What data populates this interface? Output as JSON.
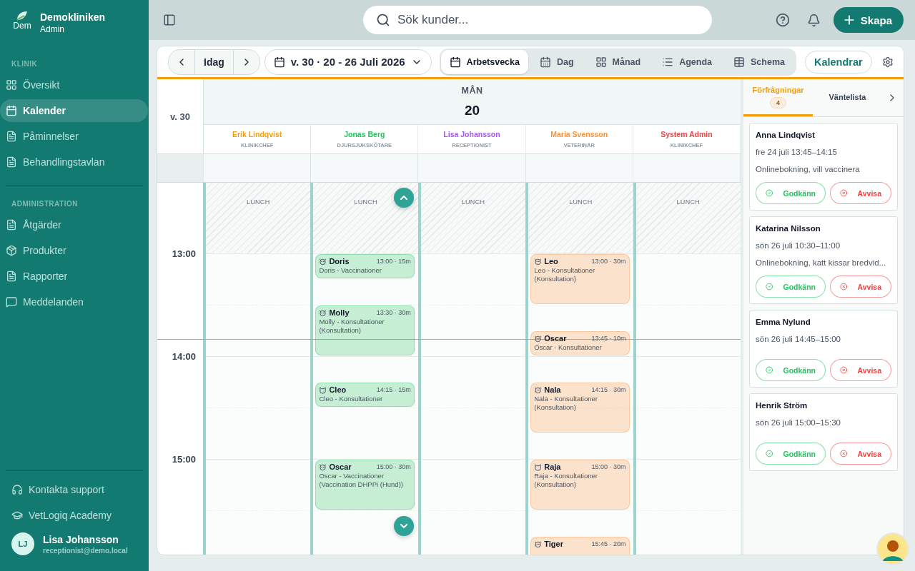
{
  "sidebar": {
    "clinic": {
      "logo_alt": "Dem",
      "name": "Demokliniken",
      "role": "Admin"
    },
    "sections": [
      {
        "title": "KLINIK",
        "items": [
          {
            "label": "Översikt",
            "kind": "grid",
            "selected": false
          },
          {
            "label": "Kalender",
            "kind": "calendar",
            "selected": true
          },
          {
            "label": "Påminnelser",
            "kind": "document",
            "selected": false
          },
          {
            "label": "Behandlingstavlan",
            "kind": "document",
            "selected": false
          }
        ]
      },
      {
        "title": "ADMINISTRATION",
        "items": [
          {
            "label": "Åtgärder",
            "kind": "document",
            "selected": false
          },
          {
            "label": "Produkter",
            "kind": "box",
            "selected": false
          },
          {
            "label": "Rapporter",
            "kind": "document",
            "selected": false
          },
          {
            "label": "Meddelanden",
            "kind": "chat",
            "selected": false
          }
        ]
      }
    ],
    "footer_links": [
      {
        "label": "Kontakta support",
        "kind": "headset"
      },
      {
        "label": "VetLogiq Academy",
        "kind": "cap"
      }
    ],
    "user": {
      "initials": "LJ",
      "name": "Lisa Johansson",
      "email": "receptionist@demo.local"
    }
  },
  "topbar": {
    "search": {
      "placeholder": "Sök kunder..."
    },
    "create_button": "Skapa"
  },
  "toolbar": {
    "today": "Idag",
    "range": "v. 30 · 20 - 26 Juli 2026",
    "views": [
      {
        "label": "Arbetsvecka",
        "kind": "calendar",
        "selected": true
      },
      {
        "label": "Dag",
        "kind": "dots",
        "selected": false
      },
      {
        "label": "Månad",
        "kind": "grid",
        "selected": false
      },
      {
        "label": "Agenda",
        "kind": "list",
        "selected": false
      },
      {
        "label": "Schema",
        "kind": "table",
        "selected": false
      }
    ],
    "calendars_button": "Kalendrar"
  },
  "calendar": {
    "week": "v. 30",
    "day_name": "MÅN",
    "day_number": "20",
    "hours": [
      "13:00",
      "14:00",
      "15:00"
    ],
    "now_line": true,
    "staff": [
      {
        "name": "Erik Lindqvist",
        "role": "KLINIKCHEF",
        "color": "#f59e0b",
        "lunch": "LUNCH"
      },
      {
        "name": "Jonas Berg",
        "role": "DJURSJUKSKÖTARE",
        "color": "#22c55e",
        "lunch": "LUNCH",
        "appointments": [
          {
            "kind": "dog",
            "name": "Doris",
            "time": "13:00 · 15m",
            "description": "Doris - Vaccinationer"
          },
          {
            "kind": "dog",
            "name": "Molly",
            "time": "13:30 · 30m",
            "description": "Molly - Konsultationer (Konsultation)"
          },
          {
            "kind": "cat",
            "name": "Cleo",
            "time": "14:15 · 15m",
            "description": "Cleo - Konsultationer"
          },
          {
            "kind": "dog",
            "name": "Oscar",
            "time": "15:00 · 30m",
            "description": "Oscar - Vaccinationer (Vaccination DHPPi (Hund))"
          }
        ]
      },
      {
        "name": "Lisa Johansson",
        "role": "RECEPTIONIST",
        "color": "#a855f7",
        "lunch": "LUNCH"
      },
      {
        "name": "Maria Svensson",
        "role": "VETERINÄR",
        "color": "#fb923c",
        "lunch": "LUNCH",
        "appointments": [
          {
            "kind": "dog",
            "name": "Leo",
            "time": "13:00 · 30m",
            "description": "Leo - Konsultationer (Konsultation)"
          },
          {
            "kind": "dog",
            "name": "Oscar",
            "time": "13:45 · 10m",
            "description": "Oscar - Konsultationer"
          },
          {
            "kind": "dog",
            "name": "Nala",
            "time": "14:15 · 30m",
            "description": "Nala - Konsultationer (Konsultation)"
          },
          {
            "kind": "cat",
            "name": "Raja",
            "time": "15:00 · 30m",
            "description": "Raja - Konsultationer (Konsultation)"
          },
          {
            "kind": "dog",
            "name": "Tiger",
            "time": "15:45 · 20m"
          }
        ]
      },
      {
        "name": "System Admin",
        "role": "KLINIKCHEF",
        "color": "#ef4444",
        "lunch": "LUNCH"
      }
    ]
  },
  "requests": {
    "tabs": [
      {
        "label": "Förfrågningar",
        "badge": "4",
        "selected": true
      },
      {
        "label": "Väntelista",
        "selected": false
      }
    ],
    "items": [
      {
        "name": "Anna Lindqvist",
        "when": "fre 24 juli 13:45–14:15",
        "note": "Onlinebokning, vill vaccinera",
        "approve": "Godkänn",
        "reject": "Avvisa"
      },
      {
        "name": "Katarina Nilsson",
        "when": "sön 26 juli 10:30–11:00",
        "note": "Onlinebokning, katt kissar bredvid...",
        "approve": "Godkänn",
        "reject": "Avvisa"
      },
      {
        "name": "Emma Nylund",
        "when": "sön 26 juli 14:45–15:00",
        "approve": "Godkänn",
        "reject": "Avvisa"
      },
      {
        "name": "Henrik Ström",
        "when": "sön 26 juli 15:00–15:30",
        "approve": "Godkänn",
        "reject": "Avvisa"
      }
    ]
  }
}
